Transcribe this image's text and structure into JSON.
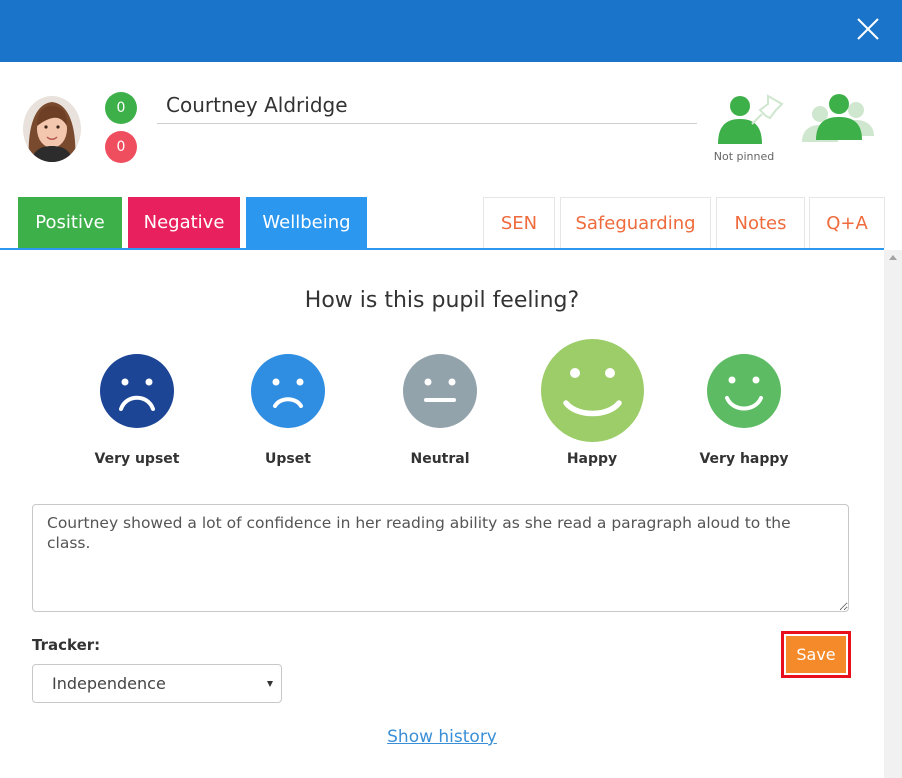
{
  "window": {
    "close_icon": "close-icon"
  },
  "pupil": {
    "name": "Courtney Aldridge",
    "positive_count": "0",
    "negative_count": "0",
    "pin_status": "Not pinned"
  },
  "tabs": {
    "positive": "Positive",
    "negative": "Negative",
    "wellbeing": "Wellbeing",
    "sen": "SEN",
    "safeguarding": "Safeguarding",
    "notes": "Notes",
    "qa": "Q+A"
  },
  "wellbeing": {
    "question": "How is this pupil feeling?",
    "moods": [
      {
        "label": "Very upset",
        "color": "#1c4596"
      },
      {
        "label": "Upset",
        "color": "#2f8ee2"
      },
      {
        "label": "Neutral",
        "color": "#93a3ab"
      },
      {
        "label": "Happy",
        "color": "#9ccd68",
        "selected": true
      },
      {
        "label": "Very happy",
        "color": "#5dbb63"
      }
    ],
    "comment": "Courtney showed a lot of confidence in her reading ability as she read a paragraph aloud to the class."
  },
  "tracker": {
    "label": "Tracker:",
    "selected": "Independence"
  },
  "actions": {
    "save": "Save",
    "show_history": "Show history"
  },
  "colors": {
    "header": "#1a74c9",
    "positive": "#3eb04a",
    "negative": "#e8205e",
    "wellbeing": "#2b97ef",
    "tab_text_outline": "#ef6a3c",
    "save": "#f48a2a"
  }
}
